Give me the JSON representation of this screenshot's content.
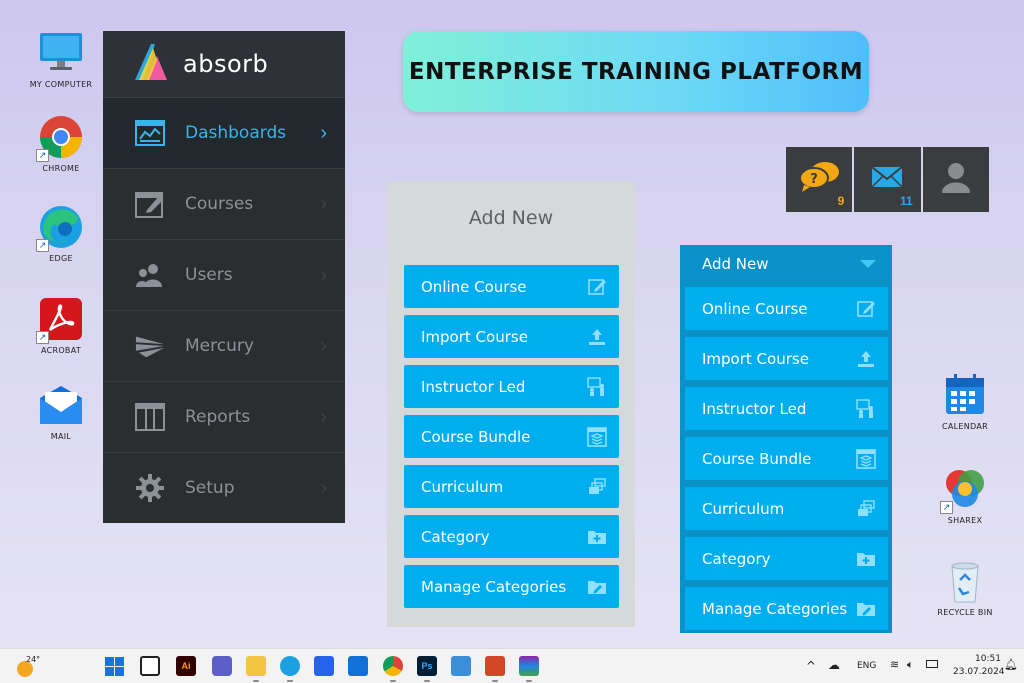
{
  "desktop": {
    "left_icons": [
      {
        "label": "MY COMPUTER",
        "icon": "monitor-icon"
      },
      {
        "label": "CHROME",
        "icon": "chrome-icon"
      },
      {
        "label": "EDGE",
        "icon": "edge-icon"
      },
      {
        "label": "ACROBAT",
        "icon": "acrobat-icon"
      },
      {
        "label": "MAIL",
        "icon": "mail-icon"
      }
    ],
    "right_icons": [
      {
        "label": "CALENDAR",
        "icon": "calendar-icon"
      },
      {
        "label": "SHAREX",
        "icon": "sharex-icon"
      },
      {
        "label": "RECYCLE BIN",
        "icon": "recycle-bin-icon"
      }
    ]
  },
  "absorb": {
    "brand": "absorb",
    "nav": [
      {
        "label": "Dashboards",
        "icon": "dashboard-icon",
        "active": true
      },
      {
        "label": "Courses",
        "icon": "courses-icon",
        "active": false
      },
      {
        "label": "Users",
        "icon": "users-icon",
        "active": false
      },
      {
        "label": "Mercury",
        "icon": "mercury-icon",
        "active": false
      },
      {
        "label": "Reports",
        "icon": "reports-icon",
        "active": false
      },
      {
        "label": "Setup",
        "icon": "gear-icon",
        "active": false
      }
    ]
  },
  "banner": {
    "title": "ENTERPRISE TRAINING PLATFORM"
  },
  "tools": {
    "chat_count": "9",
    "mail_count": "11"
  },
  "add_new_panel": {
    "title": "Add New",
    "items": [
      {
        "label": "Online Course",
        "icon": "edit-icon"
      },
      {
        "label": "Import Course",
        "icon": "upload-icon"
      },
      {
        "label": "Instructor Led",
        "icon": "instructor-icon"
      },
      {
        "label": "Course Bundle",
        "icon": "bundle-icon"
      },
      {
        "label": "Curriculum",
        "icon": "curriculum-icon"
      },
      {
        "label": "Category",
        "icon": "folder-add-icon"
      },
      {
        "label": "Manage Categories",
        "icon": "folder-edit-icon"
      }
    ]
  },
  "add_new_dropdown": {
    "title": "Add New",
    "items": [
      {
        "label": "Online Course",
        "icon": "edit-icon"
      },
      {
        "label": "Import Course",
        "icon": "upload-icon"
      },
      {
        "label": "Instructor Led",
        "icon": "instructor-icon"
      },
      {
        "label": "Course Bundle",
        "icon": "bundle-icon"
      },
      {
        "label": "Curriculum",
        "icon": "curriculum-icon"
      },
      {
        "label": "Category",
        "icon": "folder-add-icon"
      },
      {
        "label": "Manage Categories",
        "icon": "folder-edit-icon"
      }
    ]
  },
  "taskbar": {
    "weather_temp": "24°",
    "lang": "ENG",
    "time": "10:51",
    "date": "23.07.2024"
  },
  "colors": {
    "accent": "#00aeef",
    "sidebar_bg": "#2b2e31",
    "active_text": "#39b3e8",
    "dropdown_bg": "#0a91c8"
  }
}
